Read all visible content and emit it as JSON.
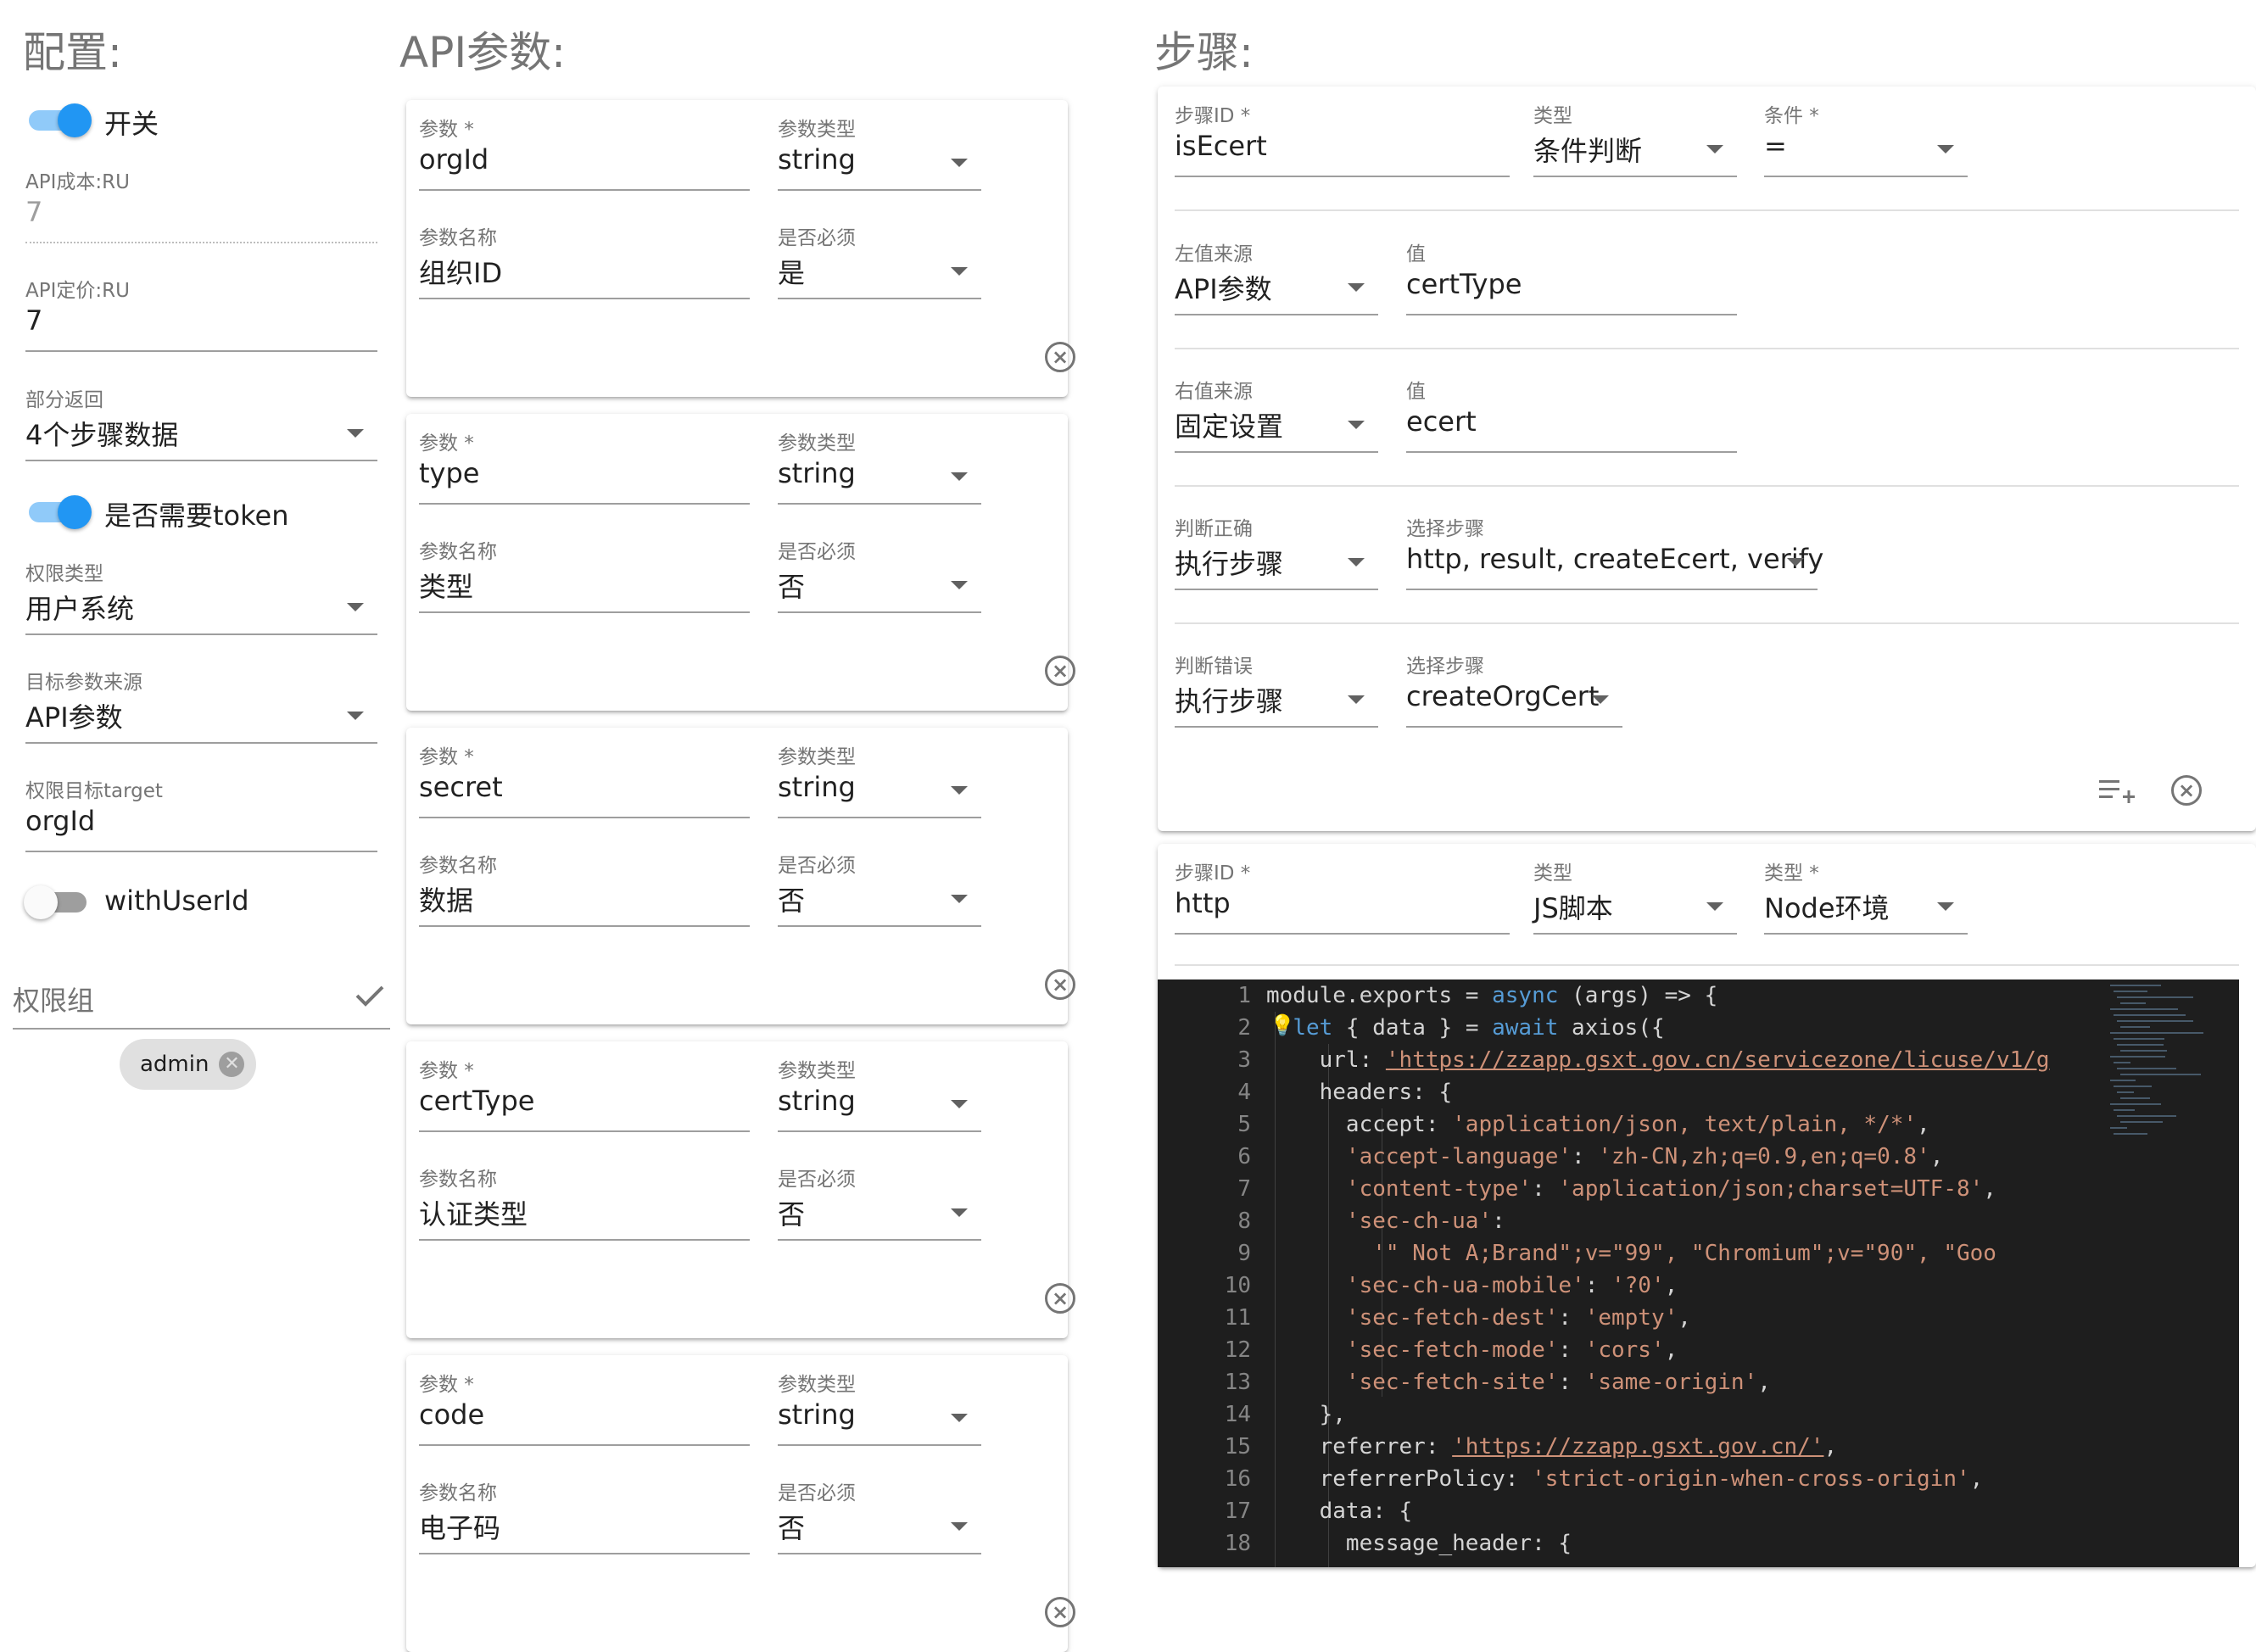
{
  "config": {
    "title": "配置:",
    "switch_enabled": {
      "label": "开关",
      "on": true
    },
    "api_cost": {
      "label": "API成本:RU",
      "value": "7"
    },
    "api_price": {
      "label": "API定价:RU",
      "value": "7"
    },
    "partial_return": {
      "label": "部分返回",
      "value": "4个步骤数据"
    },
    "need_token": {
      "label": "是否需要token",
      "on": true
    },
    "permission_type": {
      "label": "权限类型",
      "value": "用户系统"
    },
    "target_param_source": {
      "label": "目标参数来源",
      "value": "API参数"
    },
    "permission_target": {
      "label": "权限目标target",
      "value": "orgId"
    },
    "with_user_id": {
      "label": "withUserId",
      "on": false
    },
    "permission_group": {
      "label": "权限组",
      "chip": "admin"
    }
  },
  "api_params": {
    "title": "API参数:",
    "labels": {
      "param": "参数 *",
      "param_type": "参数类型",
      "param_name": "参数名称",
      "required": "是否必须"
    },
    "items": [
      {
        "param": "orgId",
        "type": "string",
        "name": "组织ID",
        "required": "是"
      },
      {
        "param": "type",
        "type": "string",
        "name": "类型",
        "required": "否"
      },
      {
        "param": "secret",
        "type": "string",
        "name": "数据",
        "required": "否"
      },
      {
        "param": "certType",
        "type": "string",
        "name": "认证类型",
        "required": "否"
      },
      {
        "param": "code",
        "type": "string",
        "name": "电子码",
        "required": "否"
      }
    ]
  },
  "steps": {
    "title": "步骤:",
    "step1": {
      "id_label": "步骤ID *",
      "id": "isEcert",
      "type_label": "类型",
      "type": "条件判断",
      "cond_label": "条件 *",
      "cond": "=",
      "left_source_label": "左值来源",
      "left_source": "API参数",
      "left_value_label": "值",
      "left_value": "certType",
      "right_source_label": "右值来源",
      "right_source": "固定设置",
      "right_value_label": "值",
      "right_value": "ecert",
      "true_label": "判断正确",
      "true_action": "执行步骤",
      "true_steps_label": "选择步骤",
      "true_steps": "http, result, createEcert, verify",
      "false_label": "判断错误",
      "false_action": "执行步骤",
      "false_steps_label": "选择步骤",
      "false_steps": "createOrgCert"
    },
    "step2": {
      "id_label": "步骤ID *",
      "id": "http",
      "type_label": "类型",
      "type": "JS脚本",
      "env_label": "类型 *",
      "env": "Node环境"
    },
    "code": {
      "line_numbers": [
        "1",
        "2",
        "3",
        "4",
        "5",
        "6",
        "7",
        "8",
        "9",
        "10",
        "11",
        "12",
        "13",
        "14",
        "15",
        "16",
        "17",
        "18"
      ],
      "lines": [
        "module.exports = async (args) => {",
        "  let { data } = await axios({",
        "    url: 'https://zzapp.gsxt.gov.cn/servicezone/licuse/v1/g",
        "    headers: {",
        "      accept: 'application/json, text/plain, */*',",
        "      'accept-language': 'zh-CN,zh;q=0.9,en;q=0.8',",
        "      'content-type': 'application/json;charset=UTF-8',",
        "      'sec-ch-ua':",
        "        '\" Not A;Brand\";v=\"99\", \"Chromium\";v=\"90\", \"Goo",
        "      'sec-ch-ua-mobile': '?0',",
        "      'sec-fetch-dest': 'empty',",
        "      'sec-fetch-mode': 'cors',",
        "      'sec-fetch-site': 'same-origin',",
        "    },",
        "    referrer: 'https://zzapp.gsxt.gov.cn/',",
        "    referrerPolicy: 'strict-origin-when-cross-origin',",
        "    data: {",
        "      message_header: {"
      ]
    }
  }
}
